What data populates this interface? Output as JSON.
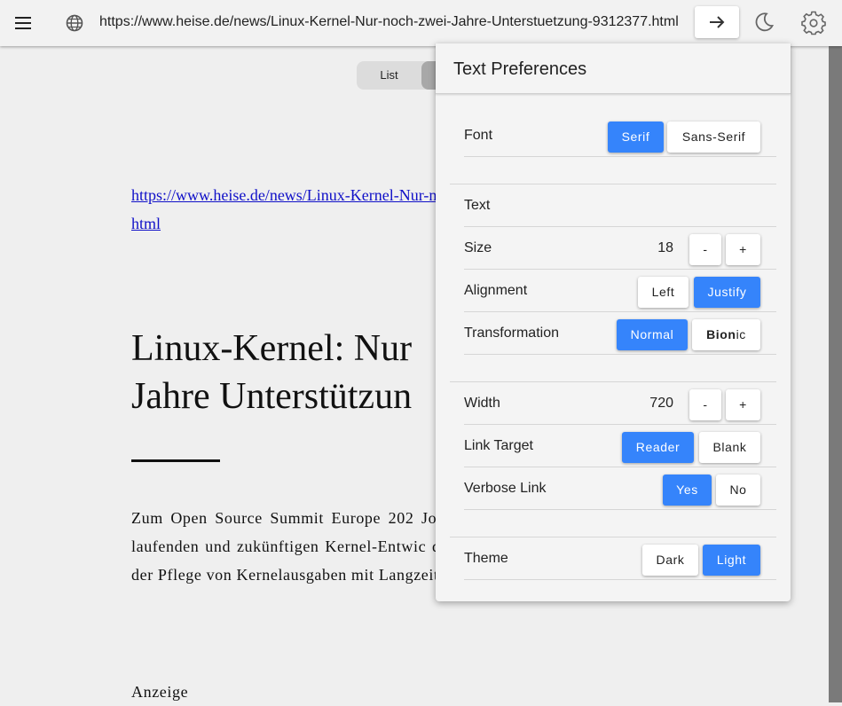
{
  "toolbar": {
    "url": "https://www.heise.de/news/Linux-Kernel-Nur-noch-zwei-Jahre-Unterstuetzung-9312377.html"
  },
  "view_toggle": {
    "list_label": "List"
  },
  "article": {
    "link": "https://www.heise.de/news/Linux-Kernel-N                                        9312377.html",
    "title_lines": [
      "Linux-Kernel: Nur",
      "Jahre Unterstützun"
    ],
    "paragraph": "Zum Open Source Summit Europe 202 Jonathan Corbet, Chefredakteur bei LW laufenden und zukünftigen Kernel-Entwic die anhaltenden Herausforderungen bei der Pflege von Kernelausgaben mit Langzeitsupport, den LTS-Kernelversionen.",
    "anzeige": "Anzeige"
  },
  "panel": {
    "title": "Text Preferences",
    "font": {
      "label": "Font",
      "options": [
        "Serif",
        "Sans-Serif"
      ],
      "selected": "Serif"
    },
    "text_section": {
      "label": "Text"
    },
    "size": {
      "label": "Size",
      "value": "18",
      "minus": "-",
      "plus": "+"
    },
    "alignment": {
      "label": "Alignment",
      "options": [
        "Left",
        "Justify"
      ],
      "selected": "Justify"
    },
    "transformation": {
      "label": "Transformation",
      "options": [
        "Normal",
        "Bionic"
      ],
      "selected": "Normal",
      "bionic_bold": "Bion",
      "bionic_rest": "ic"
    },
    "width": {
      "label": "Width",
      "value": "720",
      "minus": "-",
      "plus": "+"
    },
    "link_target": {
      "label": "Link Target",
      "options": [
        "Reader",
        "Blank"
      ],
      "selected": "Reader"
    },
    "verbose_link": {
      "label": "Verbose Link",
      "options": [
        "Yes",
        "No"
      ],
      "selected": "Yes"
    },
    "theme": {
      "label": "Theme",
      "options": [
        "Dark",
        "Light"
      ],
      "selected": "Light"
    }
  },
  "colors": {
    "accent": "#3584fb",
    "link": "#1010c8",
    "background": "#efefef"
  },
  "icons": [
    "menu-icon",
    "globe-icon",
    "arrow-right-icon",
    "moon-icon",
    "gear-icon"
  ]
}
